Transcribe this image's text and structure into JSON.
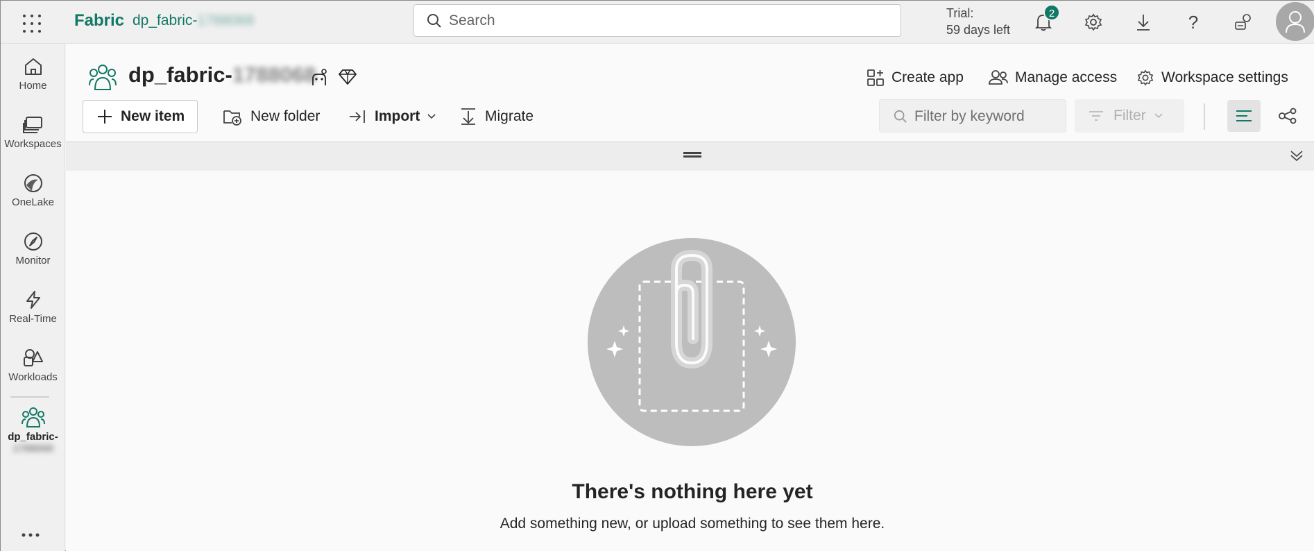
{
  "topbar": {
    "brand": "Fabric",
    "workspace_crumb_prefix": "dp_fabric-",
    "workspace_crumb_obscured": "1788068",
    "search_placeholder": "Search",
    "trial_line1": "Trial:",
    "trial_line2": "59 days left",
    "notification_count": "2",
    "icons": [
      "app-launcher-icon",
      "search-icon",
      "bell-icon",
      "gear-icon",
      "download-icon",
      "help-icon",
      "share-feedback-icon",
      "user-avatar-icon"
    ]
  },
  "rail": {
    "items": [
      {
        "label": "Home",
        "icon": "home-icon"
      },
      {
        "label": "Workspaces",
        "icon": "workspaces-icon"
      },
      {
        "label": "OneLake",
        "icon": "onelake-icon"
      },
      {
        "label": "Monitor",
        "icon": "monitor-icon"
      },
      {
        "label": "Real-Time",
        "icon": "real-time-icon"
      },
      {
        "label": "Workloads",
        "icon": "workloads-icon"
      }
    ],
    "active_label_line1": "dp_fabric-",
    "active_label_obscured": "1788068",
    "more_label": "..."
  },
  "workspace": {
    "title_prefix": "dp_fabric-",
    "title_obscured": "1788068",
    "actions": {
      "create_app": "Create app",
      "manage_access": "Manage access",
      "workspace_settings": "Workspace settings"
    }
  },
  "toolbar": {
    "new_item": "New item",
    "new_folder": "New folder",
    "import": "Import",
    "migrate": "Migrate",
    "filter_placeholder": "Filter by keyword",
    "filter": "Filter"
  },
  "empty_state": {
    "title": "There's nothing here yet",
    "subtitle": "Add something new, or upload something to see them here."
  },
  "colors": {
    "accent": "#117865",
    "illustration": "#bdbdbd"
  }
}
